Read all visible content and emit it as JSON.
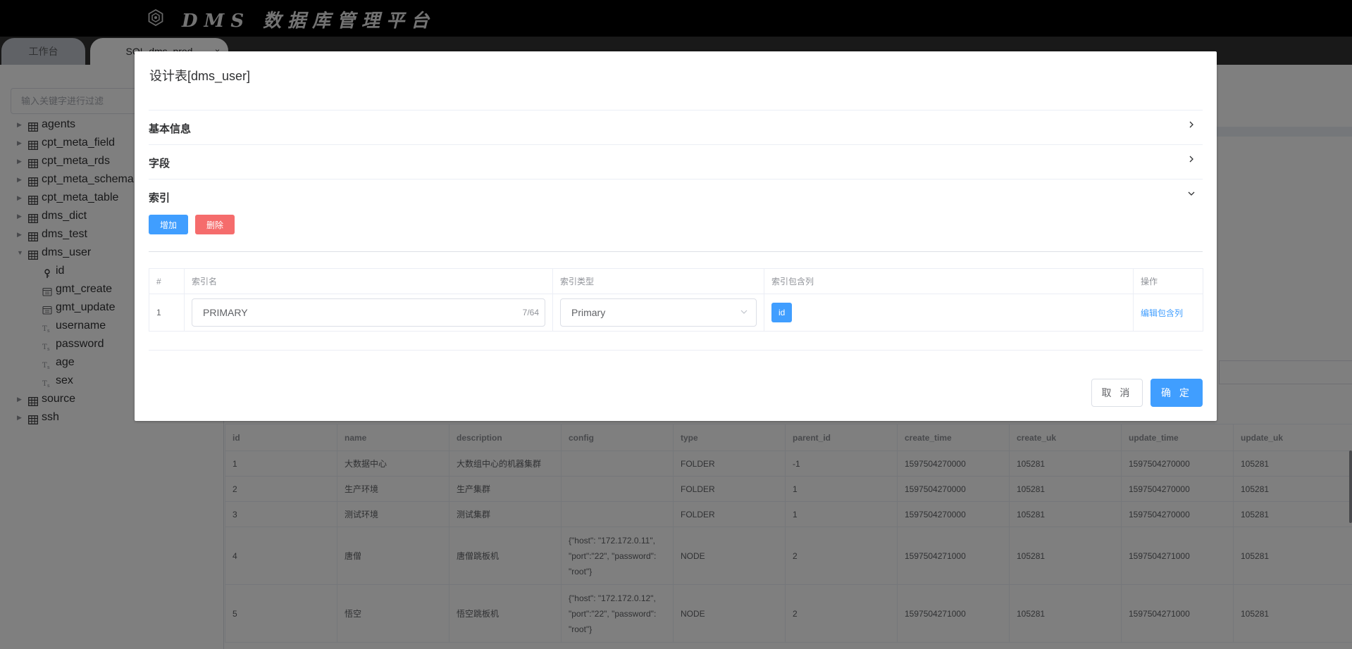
{
  "app": {
    "title": "DMS 数据库管理平台"
  },
  "tabs": [
    {
      "label": "工作台"
    },
    {
      "label": "SQL-dms_prod",
      "close": "×"
    }
  ],
  "sidebar": {
    "filter_placeholder": "输入关键字进行过滤",
    "tree": [
      {
        "label": "agents",
        "icon": "table-icon",
        "expanded": false,
        "level": 0
      },
      {
        "label": "cpt_meta_field",
        "icon": "table-icon",
        "expanded": false,
        "level": 0
      },
      {
        "label": "cpt_meta_rds",
        "icon": "table-icon",
        "expanded": false,
        "level": 0
      },
      {
        "label": "cpt_meta_schema",
        "icon": "table-icon",
        "expanded": false,
        "level": 0
      },
      {
        "label": "cpt_meta_table",
        "icon": "table-icon",
        "expanded": false,
        "level": 0
      },
      {
        "label": "dms_dict",
        "icon": "table-icon",
        "expanded": false,
        "level": 0
      },
      {
        "label": "dms_test",
        "icon": "table-icon",
        "expanded": false,
        "level": 0
      },
      {
        "label": "dms_user",
        "icon": "table-icon",
        "expanded": true,
        "level": 0
      },
      {
        "label": "id",
        "icon": "key-icon",
        "level": 1
      },
      {
        "label": "gmt_create",
        "icon": "calendar-icon",
        "level": 1
      },
      {
        "label": "gmt_update",
        "icon": "calendar-icon",
        "level": 1
      },
      {
        "label": "username",
        "icon": "text-type-icon",
        "level": 1
      },
      {
        "label": "password",
        "icon": "text-type-icon",
        "level": 1
      },
      {
        "label": "age",
        "icon": "text-type-icon",
        "level": 1
      },
      {
        "label": "sex",
        "icon": "text-type-icon",
        "level": 1
      },
      {
        "label": "source",
        "icon": "table-icon",
        "expanded": false,
        "level": 0
      },
      {
        "label": "ssh",
        "icon": "table-icon",
        "expanded": false,
        "level": 0
      }
    ]
  },
  "results": {
    "columns": [
      "id",
      "name",
      "description",
      "config",
      "type",
      "parent_id",
      "create_time",
      "create_uk",
      "update_time",
      "update_uk"
    ],
    "rows": [
      [
        "1",
        "大数据中心",
        "大数组中心的机器集群",
        "",
        "FOLDER",
        "-1",
        "1597504270000",
        "105281",
        "1597504270000",
        "105281"
      ],
      [
        "2",
        "生产环境",
        "生产集群",
        "",
        "FOLDER",
        "1",
        "1597504270000",
        "105281",
        "1597504270000",
        "105281"
      ],
      [
        "3",
        "测试环境",
        "测试集群",
        "",
        "FOLDER",
        "1",
        "1597504270000",
        "105281",
        "1597504270000",
        "105281"
      ],
      [
        "4",
        "唐僧",
        "唐僧跳板机",
        "{\"host\": \"172.172.0.11\", \"port\":\"22\", \"password\": \"root\"}",
        "NODE",
        "2",
        "1597504271000",
        "105281",
        "1597504271000",
        "105281"
      ],
      [
        "5",
        "悟空",
        "悟空跳板机",
        "{\"host\": \"172.172.0.12\", \"port\":\"22\", \"password\": \"root\"}",
        "NODE",
        "2",
        "1597504271000",
        "105281",
        "1597504271000",
        "105281"
      ]
    ]
  },
  "dialog": {
    "title": "设计表[dms_user]",
    "sections": {
      "basic": {
        "label": "基本信息"
      },
      "fields": {
        "label": "字段"
      },
      "indexes": {
        "label": "索引"
      }
    },
    "add_label": "增加",
    "delete_label": "删除",
    "index_table": {
      "headers": [
        "#",
        "索引名",
        "索引类型",
        "索引包含列",
        "操作"
      ],
      "rows": [
        {
          "num": "1",
          "name": "PRIMARY",
          "count": "7/64",
          "type": "Primary",
          "columns": [
            "id"
          ],
          "action": "编辑包含列"
        }
      ]
    },
    "cancel_label": "取 消",
    "ok_label": "确 定"
  }
}
